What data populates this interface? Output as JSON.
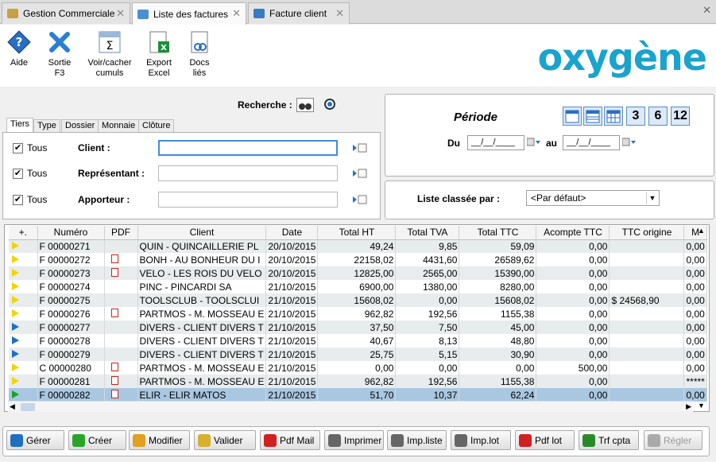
{
  "tabs": [
    {
      "label": "Gestion Commerciale",
      "icon": "cart-icon"
    },
    {
      "label": "Liste des factures",
      "icon": "invoice-list-icon"
    },
    {
      "label": "Facture client",
      "icon": "invoice-settings-icon"
    }
  ],
  "toolbar": {
    "aide": "Aide",
    "sortie_line1": "Sortie",
    "sortie_line2": "F3",
    "cumuls_line1": "Voir/cacher",
    "cumuls_line2": "cumuls",
    "export_line1": "Export",
    "export_line2": "Excel",
    "docs_line1": "Docs",
    "docs_line2": "liés"
  },
  "brand": "oxygène",
  "search": {
    "label": "Recherche :"
  },
  "filter_tabs": [
    "Tiers",
    "Type",
    "Dossier",
    "Monnaie",
    "Clôture"
  ],
  "filters": [
    {
      "checkbox": "Tous",
      "label": "Client :",
      "value": ""
    },
    {
      "checkbox": "Tous",
      "label": "Représentant :",
      "value": ""
    },
    {
      "checkbox": "Tous",
      "label": "Apporteur :",
      "value": ""
    }
  ],
  "periode": {
    "title": "Période",
    "du": "Du",
    "au": "au",
    "date_from": "__/__/____",
    "date_to": "__/__/____",
    "quick": [
      "3",
      "6",
      "12"
    ]
  },
  "sort": {
    "label": "Liste classée par :",
    "value": "<Par défaut>"
  },
  "grid": {
    "columns": [
      "Numéro",
      "PDF",
      "Client",
      "Date",
      "Total HT",
      "Total TVA",
      "Total TTC",
      "Acompte TTC",
      "TTC origine",
      "M"
    ],
    "rows": [
      {
        "flag": "yellow",
        "num": "F 00000271",
        "pdf": false,
        "client": "QUIN - QUINCAILLERIE PL",
        "date": "20/10/2015",
        "ht": "49,24",
        "tva": "9,85",
        "ttc": "59,09",
        "acompte": "0,00",
        "origine": "",
        "m": "0,00"
      },
      {
        "flag": "yellow",
        "num": "F 00000272",
        "pdf": true,
        "client": "BONH - AU BONHEUR DU I",
        "date": "20/10/2015",
        "ht": "22158,02",
        "tva": "4431,60",
        "ttc": "26589,62",
        "acompte": "0,00",
        "origine": "",
        "m": "0,00"
      },
      {
        "flag": "yellow",
        "num": "F 00000273",
        "pdf": true,
        "client": "VELO - LES ROIS DU VELO",
        "date": "20/10/2015",
        "ht": "12825,00",
        "tva": "2565,00",
        "ttc": "15390,00",
        "acompte": "0,00",
        "origine": "",
        "m": "0,00"
      },
      {
        "flag": "yellow",
        "num": "F 00000274",
        "pdf": false,
        "client": "PINC - PINCARDI SA",
        "date": "21/10/2015",
        "ht": "6900,00",
        "tva": "1380,00",
        "ttc": "8280,00",
        "acompte": "0,00",
        "origine": "",
        "m": "0,00"
      },
      {
        "flag": "yellow",
        "num": "F 00000275",
        "pdf": false,
        "client": "TOOLSCLUB - TOOLSCLUI",
        "date": "21/10/2015",
        "ht": "15608,02",
        "tva": "0,00",
        "ttc": "15608,02",
        "acompte": "0,00",
        "origine": "$ 24568,90",
        "m": "0,00"
      },
      {
        "flag": "yellow",
        "num": "F 00000276",
        "pdf": true,
        "client": "PARTMOS - M. MOSSEAU E",
        "date": "21/10/2015",
        "ht": "962,82",
        "tva": "192,56",
        "ttc": "1155,38",
        "acompte": "0,00",
        "origine": "",
        "m": "0,00"
      },
      {
        "flag": "blue",
        "num": "F 00000277",
        "pdf": false,
        "client": "DIVERS - CLIENT DIVERS T",
        "date": "21/10/2015",
        "ht": "37,50",
        "tva": "7,50",
        "ttc": "45,00",
        "acompte": "0,00",
        "origine": "",
        "m": "0,00"
      },
      {
        "flag": "blue",
        "num": "F 00000278",
        "pdf": false,
        "client": "DIVERS - CLIENT DIVERS T",
        "date": "21/10/2015",
        "ht": "40,67",
        "tva": "8,13",
        "ttc": "48,80",
        "acompte": "0,00",
        "origine": "",
        "m": "0,00"
      },
      {
        "flag": "blue",
        "num": "F 00000279",
        "pdf": false,
        "client": "DIVERS - CLIENT DIVERS T",
        "date": "21/10/2015",
        "ht": "25,75",
        "tva": "5,15",
        "ttc": "30,90",
        "acompte": "0,00",
        "origine": "",
        "m": "0,00"
      },
      {
        "flag": "yellow",
        "num": "C 00000280",
        "pdf": true,
        "client": "PARTMOS - M. MOSSEAU E",
        "date": "21/10/2015",
        "ht": "0,00",
        "tva": "0,00",
        "ttc": "0,00",
        "acompte": "500,00",
        "origine": "",
        "m": "0,00"
      },
      {
        "flag": "yellow",
        "num": "F 00000281",
        "pdf": true,
        "client": "PARTMOS - M. MOSSEAU E",
        "date": "21/10/2015",
        "ht": "962,82",
        "tva": "192,56",
        "ttc": "1155,38",
        "acompte": "0,00",
        "origine": "",
        "m": "*****"
      },
      {
        "flag": "green",
        "num": "F 00000282",
        "pdf": true,
        "client": "ELIR - ELIR MATOS",
        "date": "21/10/2015",
        "ht": "51,70",
        "tva": "10,37",
        "ttc": "62,24",
        "acompte": "0,00",
        "origine": "",
        "m": "0,00"
      }
    ]
  },
  "bottom_buttons": [
    {
      "label": "Gérer",
      "color": "#1e6fc2"
    },
    {
      "label": "Créer",
      "color": "#2aa52a"
    },
    {
      "label": "Modifier",
      "color": "#e0a020"
    },
    {
      "label": "Valider",
      "color": "#d8b030"
    },
    {
      "label": "Pdf Mail",
      "color": "#d02020"
    },
    {
      "label": "Imprimer",
      "color": "#666666"
    },
    {
      "label": "Imp.liste",
      "color": "#666666"
    },
    {
      "label": "Imp.lot",
      "color": "#666666"
    },
    {
      "label": "Pdf lot",
      "color": "#d02020"
    },
    {
      "label": "Trf cpta",
      "color": "#2a8a2a"
    },
    {
      "label": "Régler",
      "color": "#aaaaaa"
    }
  ]
}
